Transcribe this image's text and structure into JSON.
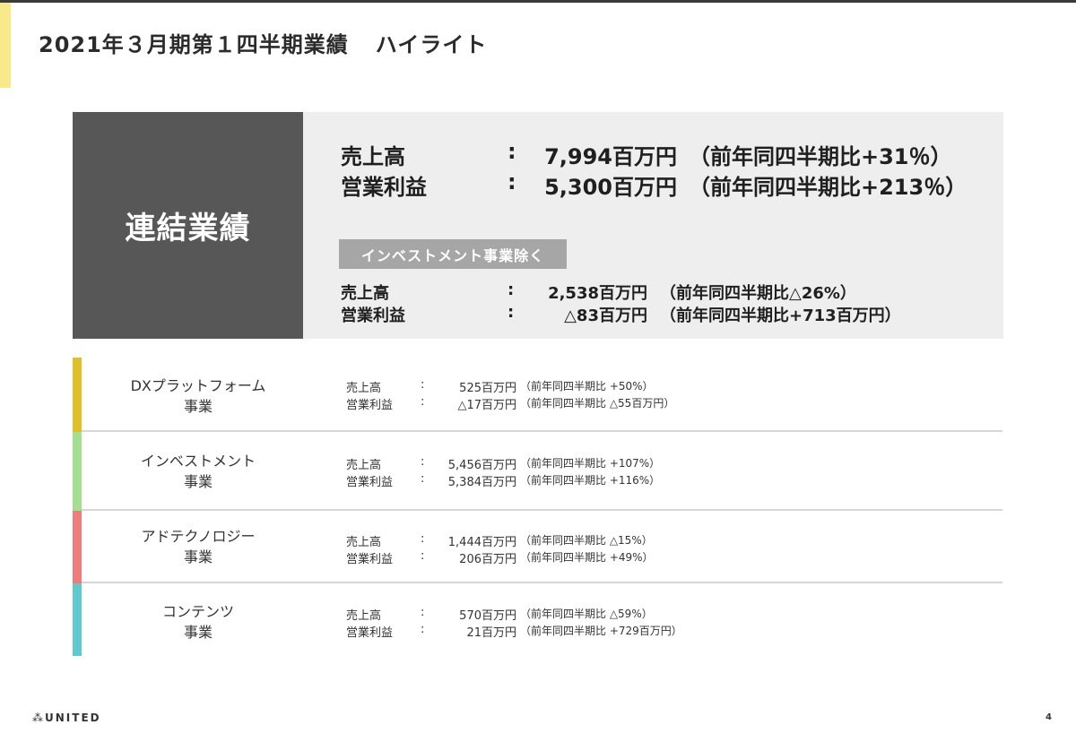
{
  "title": {
    "main": "2021年３月期第１四半期業績",
    "sub": "ハイライト"
  },
  "consolidated": {
    "label": "連結業績",
    "rows": [
      {
        "label": "売上高",
        "colon": ":",
        "value": "7,994百万円",
        "compare": "（前年同四半期比+31％）"
      },
      {
        "label": "営業利益",
        "colon": ":",
        "value": "5,300百万円",
        "compare": "（前年同四半期比+213％）"
      }
    ],
    "excl_tag": "インベストメント事業除く",
    "excl_rows": [
      {
        "label": "売上高",
        "colon": ":",
        "value": "2,538百万円",
        "compare": "（前年同四半期比△26%）"
      },
      {
        "label": "営業利益",
        "colon": ":",
        "value": "△83百万円",
        "compare": "（前年同四半期比+713百万円）"
      }
    ]
  },
  "segments": [
    {
      "name1": "DXプラットフォーム",
      "name2": "事業",
      "color": "#e1c027",
      "rows": [
        {
          "label": "売上高",
          "colon": ":",
          "value": "525百万円",
          "compare": "（前年同四半期比 +50%）"
        },
        {
          "label": "営業利益",
          "colon": ":",
          "value": "△17百万円",
          "compare": "（前年同四半期比 △55百万円）"
        }
      ]
    },
    {
      "name1": "インベストメント",
      "name2": "事業",
      "color": "#a3df8f",
      "rows": [
        {
          "label": "売上高",
          "colon": ":",
          "value": "5,456百万円",
          "compare": "（前年同四半期比 +107%）"
        },
        {
          "label": "営業利益",
          "colon": ":",
          "value": "5,384百万円",
          "compare": "（前年同四半期比 +116%）"
        }
      ]
    },
    {
      "name1": "アドテクノロジー",
      "name2": "事業",
      "color": "#f07b7d",
      "rows": [
        {
          "label": "売上高",
          "colon": ":",
          "value": "1,444百万円",
          "compare": "（前年同四半期比 △15%）"
        },
        {
          "label": "営業利益",
          "colon": ":",
          "value": "206百万円",
          "compare": "（前年同四半期比 +49%）"
        }
      ]
    },
    {
      "name1": "コンテンツ",
      "name2": "事業",
      "color": "#5fc9cc",
      "rows": [
        {
          "label": "売上高",
          "colon": ":",
          "value": "570百万円",
          "compare": "（前年同四半期比 △59%）"
        },
        {
          "label": "営業利益",
          "colon": ":",
          "value": "21百万円",
          "compare": "（前年同四半期比 +729百万円）"
        }
      ]
    }
  ],
  "footer": {
    "logo_mark": "⁂",
    "logo_text": "UNITED",
    "page": "4"
  }
}
